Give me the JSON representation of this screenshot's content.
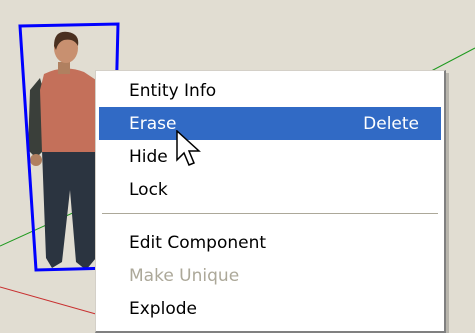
{
  "scene": {
    "background_color": "#e1ddd2",
    "selection_color": "#0000ff",
    "green_axis_color": "#1f9a1f",
    "red_axis_color": "#c83030"
  },
  "context_menu": {
    "items": [
      {
        "label": "Entity Info",
        "shortcut": "",
        "state": "normal"
      },
      {
        "label": "Erase",
        "shortcut": "Delete",
        "state": "selected"
      },
      {
        "label": "Hide",
        "shortcut": "",
        "state": "normal"
      },
      {
        "label": "Lock",
        "shortcut": "",
        "state": "normal"
      },
      {
        "label": "Edit Component",
        "shortcut": "",
        "state": "normal"
      },
      {
        "label": "Make Unique",
        "shortcut": "",
        "state": "disabled"
      },
      {
        "label": "Explode",
        "shortcut": "",
        "state": "normal"
      }
    ],
    "highlight_color": "#316ac5"
  },
  "cursor": {
    "icon": "arrow-pointer-icon"
  }
}
